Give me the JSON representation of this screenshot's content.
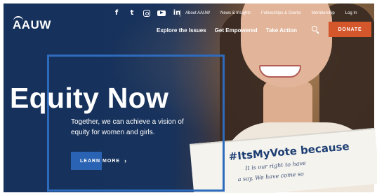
{
  "header": {
    "logo_text": "AAUW",
    "social_icons": [
      "facebook-icon",
      "twitter-icon",
      "instagram-icon",
      "youtube-icon",
      "linkedin-icon"
    ],
    "social_glyphs": {
      "facebook": "f",
      "twitter": "t",
      "linkedin": "in"
    },
    "utility_nav": [
      "About AAUW",
      "News & Insights",
      "Fellowships & Grants",
      "Membership",
      "Log In"
    ],
    "main_nav": [
      "Explore the Issues",
      "Get Empowered",
      "Take Action"
    ],
    "donate_label": "DONATE"
  },
  "hero": {
    "headline": "Equity Now",
    "subtext": "Together, we can achieve a vision of equity for women and girls.",
    "cta_label": "LEARN MORE",
    "cta_chevron": "›",
    "sign_hashtag": "#ItsMyVote because",
    "sign_handwriting_1": "It is our right to have",
    "sign_handwriting_2": "a say. We have come so"
  },
  "colors": {
    "navy": "#16315b",
    "accent_blue": "#2a63b3",
    "donate": "#d4562b"
  }
}
